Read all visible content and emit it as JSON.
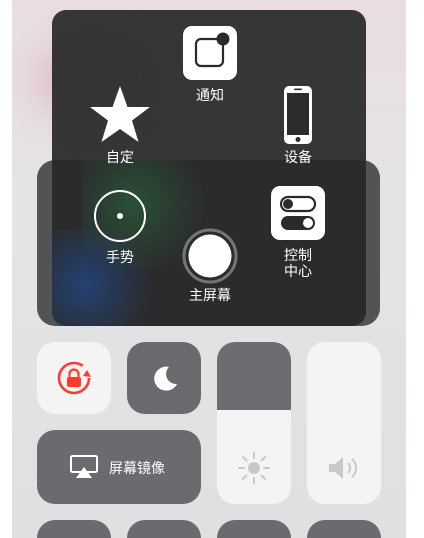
{
  "menu": {
    "notification_label": "通知",
    "custom_label": "自定",
    "device_label": "设备",
    "gesture_label": "手势",
    "control_center_label_line1": "控制",
    "control_center_label_line2": "中心",
    "home_label": "主屏幕"
  },
  "control_center": {
    "screen_mirroring_label": "屏幕镜像",
    "brightness_level": 0.58,
    "volume_level": 1.0
  },
  "colors": {
    "menu_background": "#28282a",
    "rotation_lock_accent": "#ff3b30"
  }
}
